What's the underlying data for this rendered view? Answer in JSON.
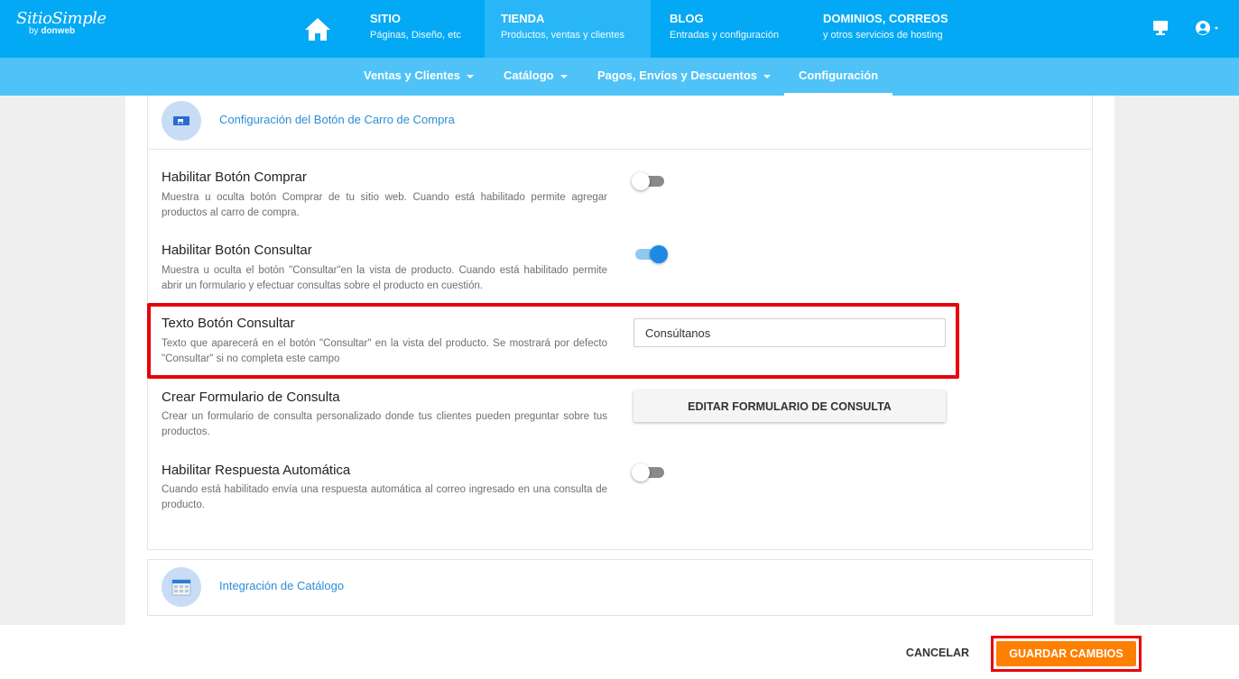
{
  "brand": {
    "name": "SitioSimple",
    "by": "by",
    "company": "donweb"
  },
  "nav": [
    {
      "title": "SITIO",
      "subtitle": "Páginas, Diseño, etc"
    },
    {
      "title": "TIENDA",
      "subtitle": "Productos, ventas y clientes"
    },
    {
      "title": "BLOG",
      "subtitle": "Entradas y configuración"
    },
    {
      "title": "DOMINIOS, CORREOS",
      "subtitle": "y otros servicios de hosting"
    }
  ],
  "subnav": [
    {
      "label": "Ventas y Clientes"
    },
    {
      "label": "Catálogo"
    },
    {
      "label": "Pagos, Envíos y Descuentos"
    },
    {
      "label": "Configuración"
    }
  ],
  "section_cart": {
    "title": "Configuración del Botón de Carro de Compra",
    "settings": [
      {
        "title": "Habilitar Botón Comprar",
        "description": "Muestra u oculta botón Comprar de tu sitio web. Cuando está habilitado permite agregar productos al carro de compra.",
        "enabled": false
      },
      {
        "title": "Habilitar Botón Consultar",
        "description": "Muestra u oculta el botón \"Consultar\"en la vista de producto. Cuando está habilitado permite abrir un formulario y efectuar consultas sobre el producto en cuestión.",
        "enabled": true
      },
      {
        "title": "Texto Botón Consultar",
        "description": "Texto que aparecerá en el botón \"Consultar\" en la vista del producto. Se mostrará por defecto \"Consultar\" si no completa este campo",
        "value": "Consúltanos"
      },
      {
        "title": "Crear Formulario de Consulta",
        "description": "Crear un formulario de consulta personalizado donde tus clientes pueden preguntar sobre tus productos.",
        "button_label": "EDITAR FORMULARIO DE CONSULTA"
      },
      {
        "title": "Habilitar Respuesta Automática",
        "description": "Cuando está habilitado envía una respuesta automática al correo ingresado en una consulta de producto.",
        "enabled": false
      }
    ]
  },
  "section_catalog": {
    "title": "Integración de Catálogo"
  },
  "footer": {
    "cancel_label": "CANCELAR",
    "save_label": "GUARDAR CAMBIOS"
  },
  "colors": {
    "primary": "#03a9f4",
    "subbar": "#4fc3f7",
    "accent": "#ff7f00",
    "highlight": "#e8000b",
    "link": "#2b8dd6"
  }
}
